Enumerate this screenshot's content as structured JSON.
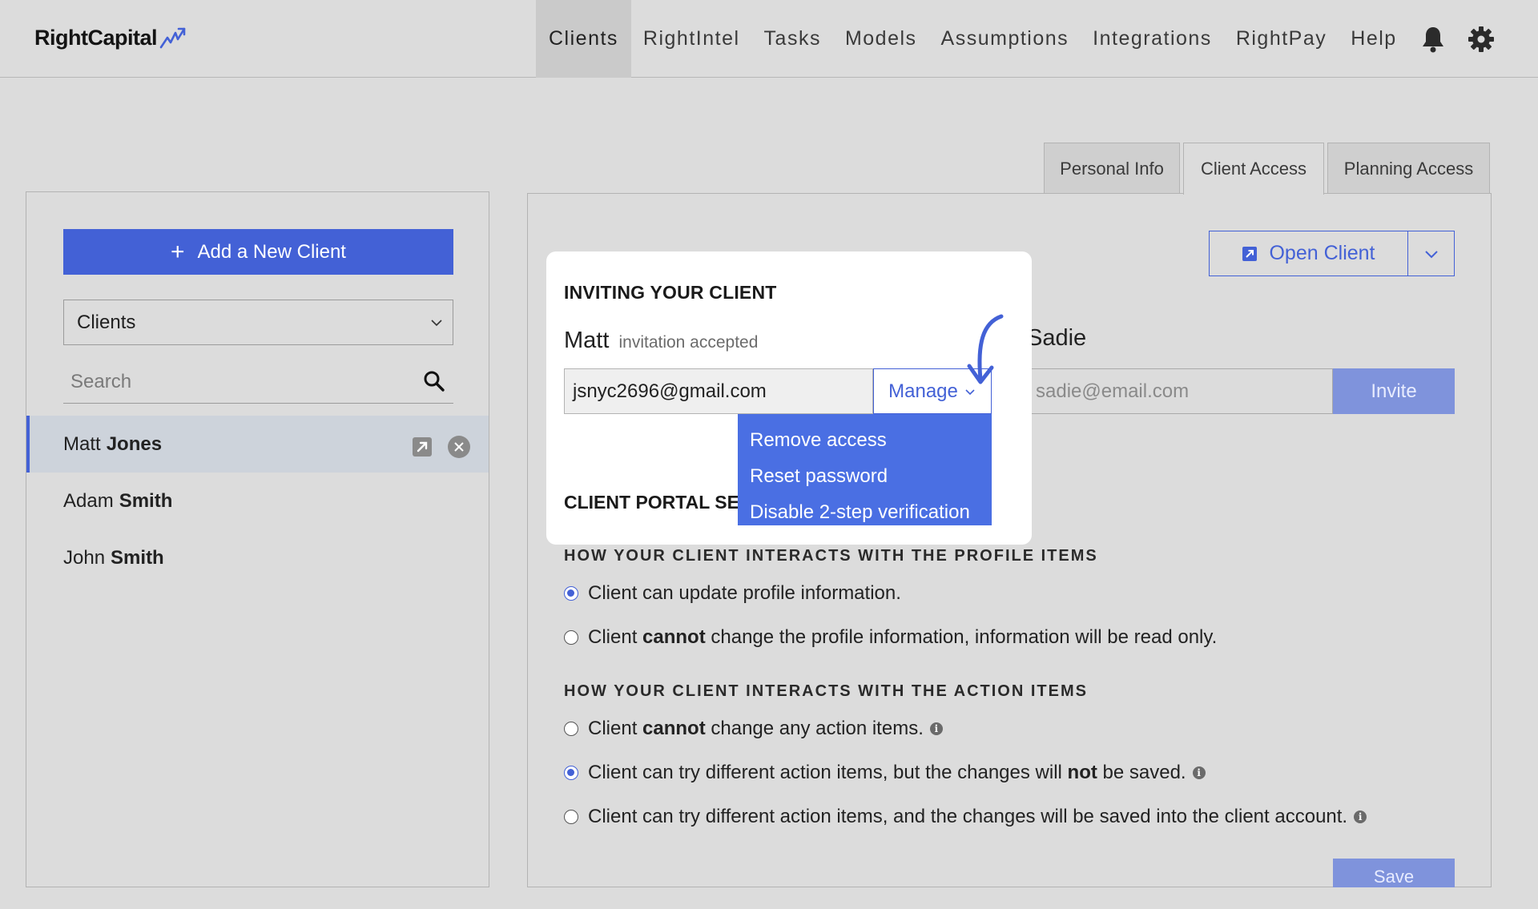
{
  "brand": {
    "name": "RightCapital",
    "accent": "#4361d6"
  },
  "nav": {
    "items": [
      "Clients",
      "RightIntel",
      "Tasks",
      "Models",
      "Assumptions",
      "Integrations",
      "RightPay",
      "Help"
    ],
    "active": "Clients",
    "icons": [
      "bell-icon",
      "gear-icon"
    ]
  },
  "sidebar": {
    "add_button": "Add a New Client",
    "filter_selected": "Clients",
    "search_placeholder": "Search",
    "clients": [
      {
        "first": "Matt",
        "last": "Jones",
        "selected": true
      },
      {
        "first": "Adam",
        "last": "Smith",
        "selected": false
      },
      {
        "first": "John",
        "last": "Smith",
        "selected": false
      }
    ]
  },
  "tabs": [
    "Personal Info",
    "Client Access",
    "Planning Access"
  ],
  "active_tab": "Client Access",
  "main": {
    "open_client": "Open Client",
    "inviting": {
      "title": "INVITING YOUR CLIENT",
      "primary_name": "Matt",
      "primary_status": "invitation accepted",
      "primary_email": "jsnyc2696@gmail.com",
      "manage_label": "Manage",
      "manage_menu": [
        "Remove access",
        "Reset password",
        "Disable 2-step verification"
      ],
      "spouse_name": "Sadie",
      "spouse_email_placeholder": "sadie@email.com",
      "invite_label": "Invite"
    },
    "portal_title_visible": "CLIENT PORTAL SET",
    "profile_section": {
      "title": "HOW YOUR CLIENT INTERACTS WITH THE PROFILE ITEMS",
      "options": [
        {
          "parts": [
            "Client can update profile information."
          ],
          "checked": true
        },
        {
          "parts": [
            "Client ",
            "cannot",
            " change the profile information, information will be read only."
          ],
          "checked": false
        }
      ]
    },
    "action_section": {
      "title": "HOW YOUR CLIENT INTERACTS WITH THE ACTION ITEMS",
      "options": [
        {
          "parts": [
            "Client ",
            "cannot",
            " change any action items."
          ],
          "checked": false,
          "info": true
        },
        {
          "parts": [
            "Client can try different action items, but the changes will ",
            "not",
            " be saved."
          ],
          "checked": true,
          "info": true
        },
        {
          "parts": [
            "Client can try different action items, and the changes will be saved into the client account."
          ],
          "checked": false,
          "info": true
        }
      ]
    },
    "save_label": "Save"
  }
}
